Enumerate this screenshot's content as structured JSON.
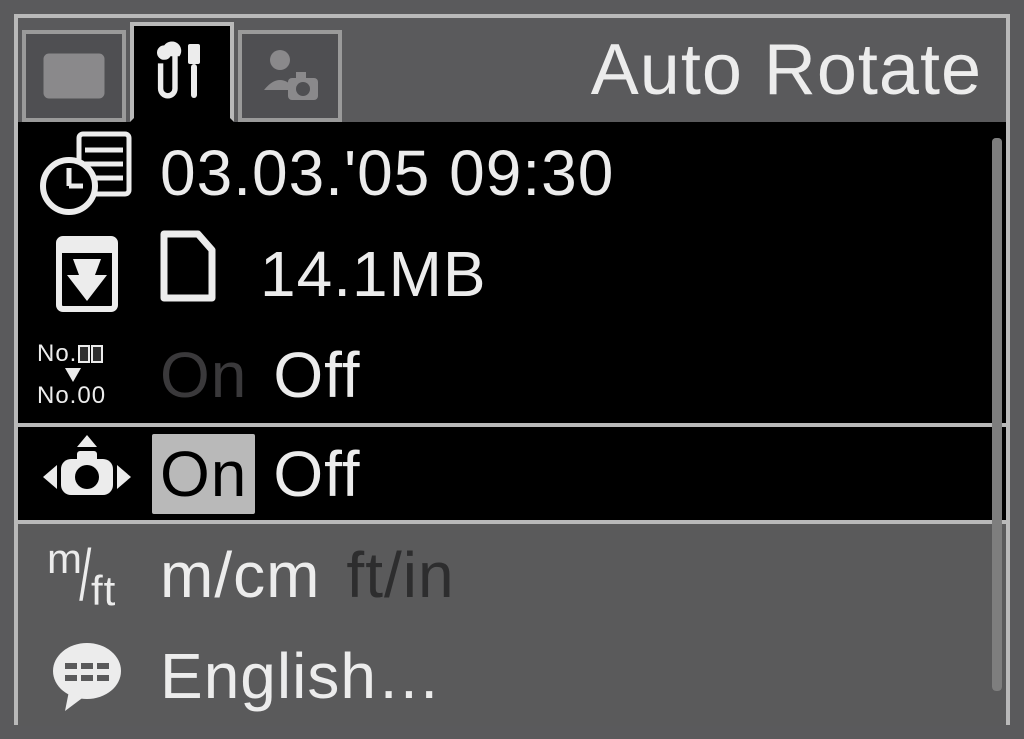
{
  "header": {
    "title": "Auto Rotate",
    "tabs": [
      {
        "id": "playback",
        "active": false
      },
      {
        "id": "setup",
        "active": true
      },
      {
        "id": "mymenu",
        "active": false
      }
    ]
  },
  "rows": {
    "datetime": {
      "value": "03.03.'05 09:30"
    },
    "format": {
      "value": "14.1MB"
    },
    "filenum": {
      "opt_on": "On",
      "opt_off": "Off",
      "selected": "Off"
    },
    "autorotate": {
      "opt_on": "On",
      "opt_off": "Off",
      "selected": "On"
    },
    "units": {
      "opt_a": "m/cm",
      "opt_b": "ft/in",
      "selected": "m/cm"
    },
    "language": {
      "value": "English…"
    }
  },
  "icon_text": {
    "no1": "No.",
    "no2": "No.00",
    "m": "m",
    "ft": "ft"
  }
}
